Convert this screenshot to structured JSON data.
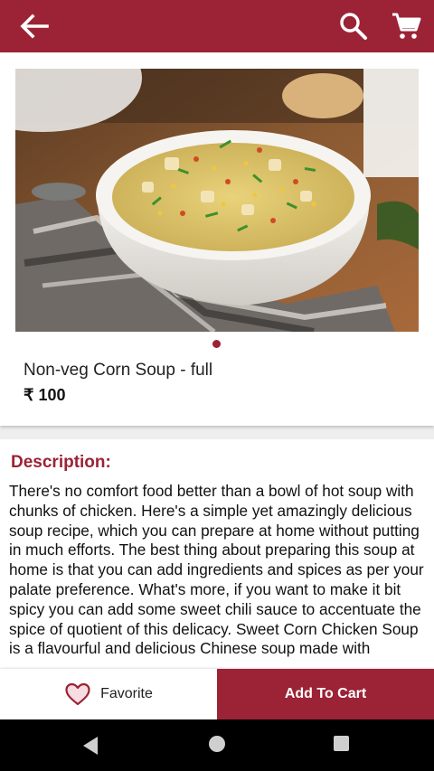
{
  "appbar": {
    "back_icon": "arrow-left-icon",
    "search_icon": "search-icon",
    "cart_icon": "cart-icon",
    "background_color": "#9b2335"
  },
  "product": {
    "image_icon": "corn-soup-photo",
    "carousel_pages": 1,
    "carousel_active": 1,
    "name": "Non-veg Corn Soup - full",
    "price": "₹ 100"
  },
  "description": {
    "title": "Description:",
    "body": "There's no comfort food better than a bowl of hot soup with chunks of chicken. Here's a simple yet amazingly delicious soup recipe, which you can prepare at home without putting in much efforts. The best thing about preparing this soup at home is that you can add ingredients and spices as per your palate preference. What's more, if you want to make it bit spicy you can add some sweet chili sauce to accentuate the spice of quotient of this delicacy. Sweet Corn Chicken Soup is a flavourful and delicious Chinese soup made with"
  },
  "actions": {
    "favorite_label": "Favorite",
    "favorite_icon": "heart-outline-icon",
    "add_to_cart_label": "Add To Cart",
    "accent_color": "#9b2335"
  },
  "system_nav": {
    "back_icon": "nav-back-icon",
    "home_icon": "nav-home-icon",
    "recents_icon": "nav-recents-icon"
  }
}
